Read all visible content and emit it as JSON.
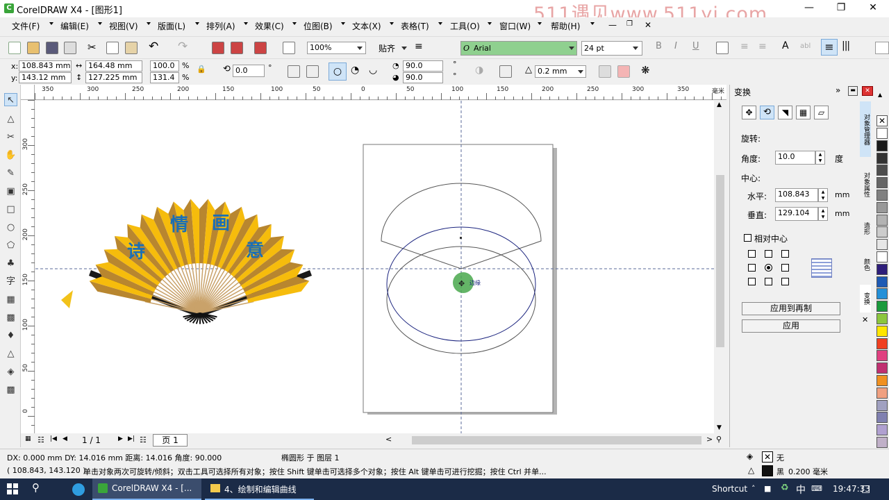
{
  "window": {
    "title": "CorelDRAW X4 - [图形1]",
    "watermark": "511遇见www.511yj.com"
  },
  "menu": [
    "文件(F)",
    "编辑(E)",
    "视图(V)",
    "版面(L)",
    "排列(A)",
    "效果(C)",
    "位图(B)",
    "文本(X)",
    "表格(T)",
    "工具(O)",
    "窗口(W)",
    "帮助(H)"
  ],
  "toolbar": {
    "zoom": "100%",
    "snap_label": "贴齐",
    "font_name": "Arial",
    "font_size": "24 pt"
  },
  "propbar": {
    "x_label": "x:",
    "x_value": "108.843 mm",
    "y_label": "y:",
    "y_value": "143.12 mm",
    "width_value": "164.48 mm",
    "height_value": "127.225 mm",
    "scale_w": "100.0",
    "scale_h": "131.4",
    "pct": "%",
    "rotation": "0.0",
    "deg": "°",
    "start_angle": "90.0",
    "end_angle": "90.0",
    "outline_width": "0.2 mm"
  },
  "hruler_labels": [
    "350",
    "300",
    "250",
    "200",
    "150",
    "100",
    "50",
    "0",
    "50",
    "100",
    "150",
    "200",
    "250",
    "300",
    "350",
    "毫米"
  ],
  "vruler_labels": [
    "300",
    "250",
    "200",
    "150",
    "100",
    "50",
    "0"
  ],
  "fan_text": {
    "c1": "情",
    "c2": "画",
    "c3": "诗",
    "c4": "意"
  },
  "cursor_label": "边缘",
  "page_nav": {
    "page_count": "1 / 1",
    "page_tab": "页 1"
  },
  "panel": {
    "title": "变换",
    "rotation_label": "旋转:",
    "angle_label": "角度:",
    "angle_value": "10.0",
    "angle_unit": "度",
    "center_label": "中心:",
    "h_label": "水平:",
    "h_value": "108.843",
    "h_unit": "mm",
    "v_label": "垂直:",
    "v_value": "129.104",
    "v_unit": "mm",
    "relative_center": "相对中心",
    "apply_dup": "应用到再制",
    "apply": "应用"
  },
  "side_tabs": [
    "对象管理器",
    "对象属性",
    "造形",
    "颜色",
    "变换"
  ],
  "palette_colors": [
    "#ffffff",
    "#1a1a1a",
    "#333333",
    "#4d4d4d",
    "#666666",
    "#808080",
    "#999999",
    "#b3b3b3",
    "#cccccc",
    "#e6e6e6",
    "#ffffff",
    "#2e1e7a",
    "#1e5ab4",
    "#2490d8",
    "#1a9a3c",
    "#8cc63e",
    "#ffe600",
    "#f04020",
    "#e04080",
    "#c03070",
    "#f09020",
    "#f0a080",
    "#a0a0c0",
    "#8080b0",
    "#b0a0d0",
    "#c0b0c8"
  ],
  "status": {
    "line1": "DX: 0.000 mm DY: 14.016 mm 距离: 14.016 角度: 90.000",
    "object": "椭圆形 于 图层 1",
    "fill_label": "无",
    "line2_coords": "( 108.843, 143.120 )",
    "hint": "单击对象两次可旋转/倾斜；双击工具可选择所有对象；按住 Shift 键单击可选择多个对象；按住 Alt 键单击可进行挖掘；按住 Ctrl 并单...",
    "outline_label": "黑",
    "outline_width": "0.200 毫米"
  },
  "taskbar": {
    "app1": "CorelDRAW X4 - [...",
    "app2": "4、绘制和编辑曲线",
    "shortcut": "Shortcut",
    "ime": "中",
    "time": "19:47:33"
  }
}
